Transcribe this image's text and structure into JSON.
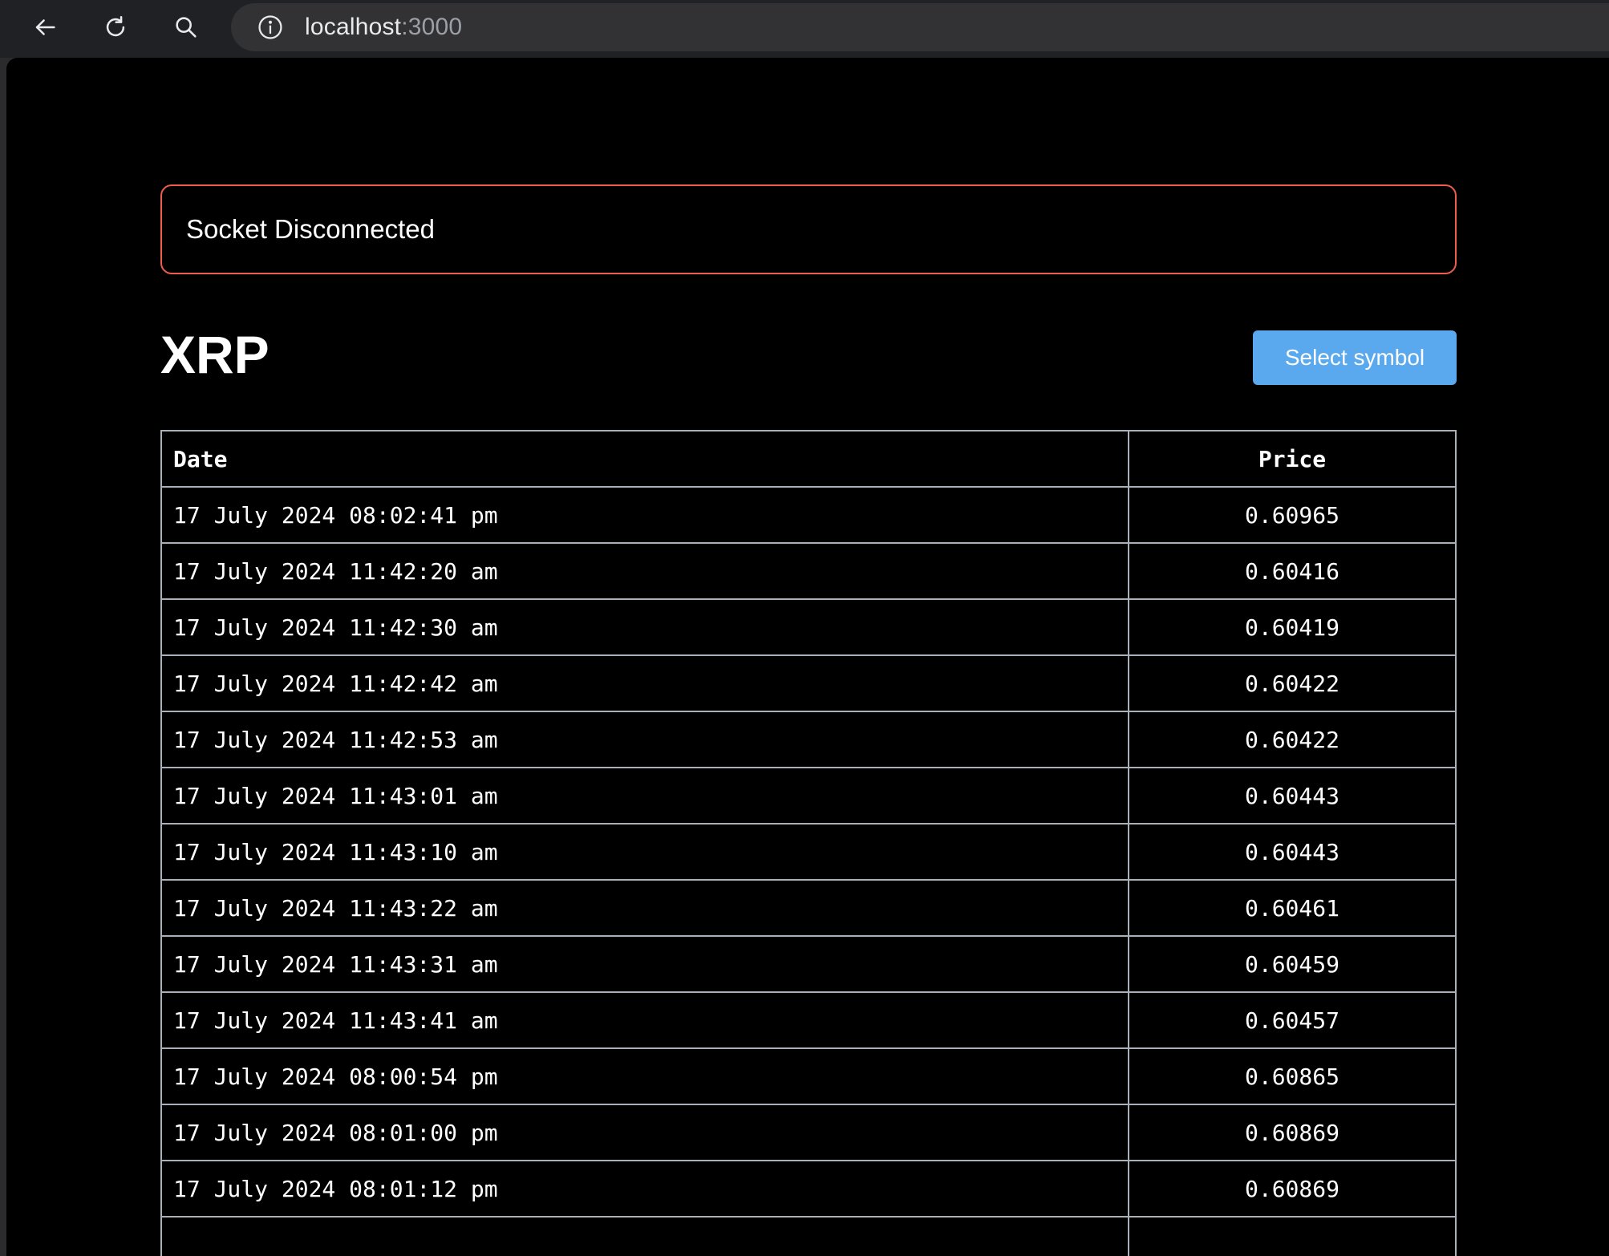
{
  "browser": {
    "url_host": "localhost",
    "url_port": ":3000",
    "icons": [
      "back-arrow-icon",
      "reload-icon",
      "search-icon",
      "info-icon"
    ]
  },
  "alert": {
    "message": "Socket Disconnected",
    "border_color": "#ef5c4b"
  },
  "header": {
    "symbol": "XRP",
    "select_button_label": "Select symbol",
    "button_color": "#5aa9ee"
  },
  "table": {
    "columns": [
      "Date",
      "Price"
    ],
    "rows": [
      {
        "date": "17 July 2024 08:02:41 pm",
        "price": "0.60965"
      },
      {
        "date": "17 July 2024 11:42:20 am",
        "price": "0.60416"
      },
      {
        "date": "17 July 2024 11:42:30 am",
        "price": "0.60419"
      },
      {
        "date": "17 July 2024 11:42:42 am",
        "price": "0.60422"
      },
      {
        "date": "17 July 2024 11:42:53 am",
        "price": "0.60422"
      },
      {
        "date": "17 July 2024 11:43:01 am",
        "price": "0.60443"
      },
      {
        "date": "17 July 2024 11:43:10 am",
        "price": "0.60443"
      },
      {
        "date": "17 July 2024 11:43:22 am",
        "price": "0.60461"
      },
      {
        "date": "17 July 2024 11:43:31 am",
        "price": "0.60459"
      },
      {
        "date": "17 July 2024 11:43:41 am",
        "price": "0.60457"
      },
      {
        "date": "17 July 2024 08:00:54 pm",
        "price": "0.60865"
      },
      {
        "date": "17 July 2024 08:01:00 pm",
        "price": "0.60869"
      },
      {
        "date": "17 July 2024 08:01:12 pm",
        "price": "0.60869"
      },
      {
        "date": "",
        "price": ""
      }
    ]
  }
}
